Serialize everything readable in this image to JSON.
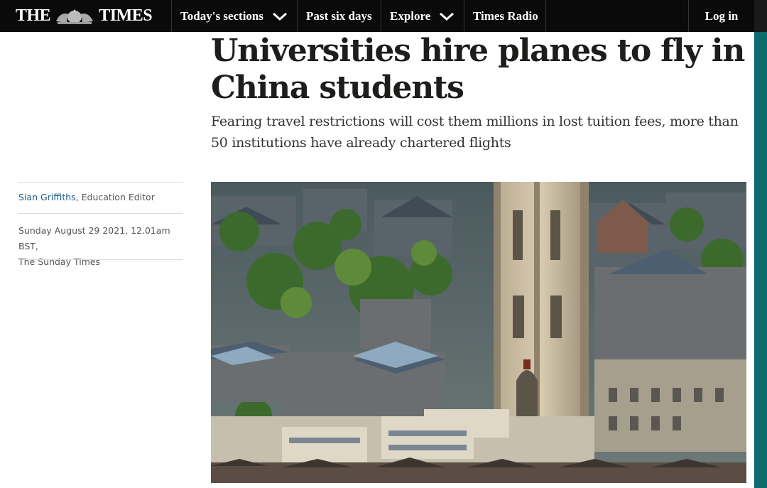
{
  "masthead": {
    "logo_left": "THE",
    "logo_right": "TIMES",
    "logo_icon": "royal-crest-icon"
  },
  "nav": {
    "items": [
      {
        "label": "Today's sections",
        "icon": "chevron-down-icon"
      },
      {
        "label": "Past six days"
      },
      {
        "label": "Explore",
        "icon": "chevron-down-icon"
      },
      {
        "label": "Times Radio"
      }
    ],
    "login_label": "Log in"
  },
  "article": {
    "headline": "Universities hire planes to fly in China students",
    "standfirst": "Fearing travel restrictions will cost them millions in lost tuition fees, more than 50 institutions have already chartered flights",
    "author_name": "Sian Griffiths",
    "author_role": ", Education Editor",
    "date": "Sunday August 29 2021, 12.01am BST,",
    "publication": "The Sunday Times",
    "hero_image": "Aerial view of a city with a gothic university tower among rooftops and trees"
  },
  "colors": {
    "nav_background": "#0a0a0a",
    "text": "#1d1d1b",
    "author_link": "#1a5a8a",
    "edge_accent": "#0f6b6e"
  }
}
